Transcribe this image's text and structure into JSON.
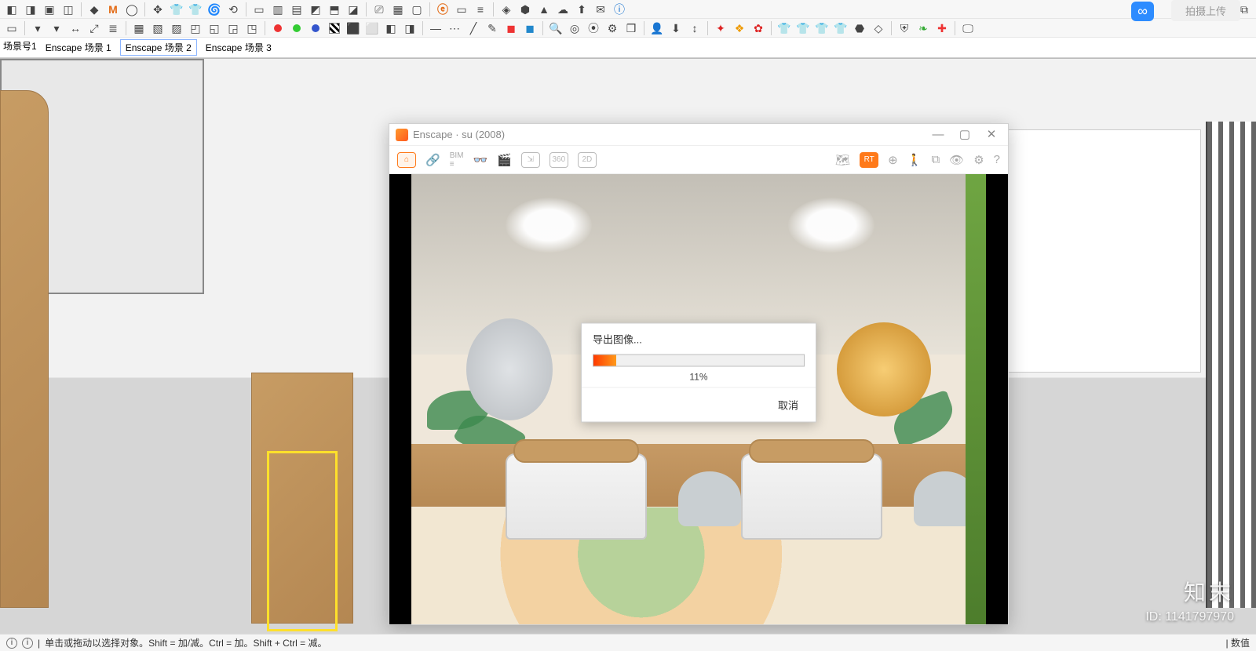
{
  "upload_button": "拍摄上传",
  "tabs": {
    "label": "场景号1",
    "items": [
      "Enscape 场景 1",
      "Enscape 场景 2",
      "Enscape 场景 3"
    ],
    "selected": 1
  },
  "enscape": {
    "title": "Enscape · su  (2008)",
    "toolbar_left": [
      "home",
      "link",
      "BIM",
      "view",
      "binoc",
      "clapper",
      "export",
      "360",
      "2d"
    ],
    "toolbar_right": [
      "map",
      "rt",
      "globe",
      "person",
      "screenshot",
      "eye",
      "gear",
      "help"
    ],
    "dialog": {
      "title": "导出图像...",
      "percent": 11,
      "percent_label": "11%",
      "cancel": "取消"
    }
  },
  "status": {
    "hint": "单击或拖动以选择对象。Shift = 加/减。Ctrl = 加。Shift + Ctrl = 减。",
    "right": "| 数值"
  },
  "watermark": {
    "name": "知末",
    "id_label": "ID: 1141797970"
  }
}
